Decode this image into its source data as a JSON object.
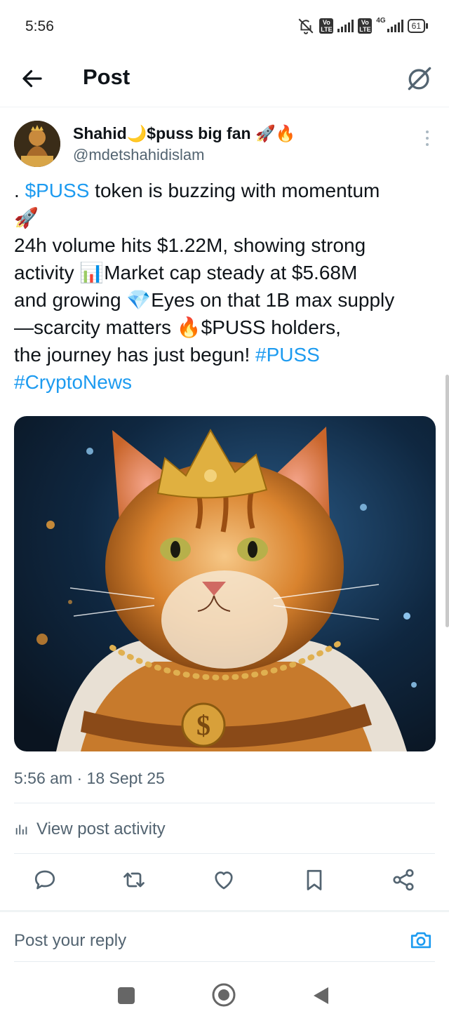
{
  "status_bar": {
    "time": "5:56",
    "network": "4G",
    "volte_1": "Vo LTE",
    "volte_2": "Vo LTE",
    "battery": "61"
  },
  "header": {
    "title": "Post",
    "back_icon": "arrow-left-icon",
    "grok_icon": "grok-icon"
  },
  "author": {
    "name": "Shahid🌙$puss big fan 🚀🔥",
    "handle": "@mdetshahidislam"
  },
  "post": {
    "lines": [
      [
        {
          "t": ". ",
          "c": ""
        },
        {
          "t": "$PUSS",
          "c": "link"
        },
        {
          "t": " token is buzzing with momentum",
          "c": ""
        }
      ],
      [
        {
          "t": "🚀",
          "c": ""
        }
      ],
      [
        {
          "t": " 24h volume hits $1.22M, showing strong",
          "c": ""
        }
      ],
      [
        {
          "t": "activity 📊Market cap steady at $5.68M",
          "c": ""
        }
      ],
      [
        {
          "t": "and growing 💎Eyes on that 1B max supply",
          "c": ""
        }
      ],
      [
        {
          "t": "—scarcity matters 🔥$PUSS holders,",
          "c": ""
        }
      ],
      [
        {
          "t": "the journey has just begun! ",
          "c": ""
        },
        {
          "t": "#PUSS",
          "c": "link"
        }
      ],
      [
        {
          "t": "#CryptoNews",
          "c": "link"
        }
      ]
    ],
    "timestamp": "5:56 am · 18 Sept 25",
    "activity_label": "View post activity"
  },
  "actions": {
    "reply_icon": "comment-icon",
    "repost_icon": "repost-icon",
    "like_icon": "heart-icon",
    "bookmark_icon": "bookmark-icon",
    "share_icon": "share-icon"
  },
  "reply_box": {
    "placeholder": "Post your reply"
  },
  "colors": {
    "link": "#1d9bf0",
    "secondary_text": "#536471",
    "primary_text": "#0f1419"
  }
}
